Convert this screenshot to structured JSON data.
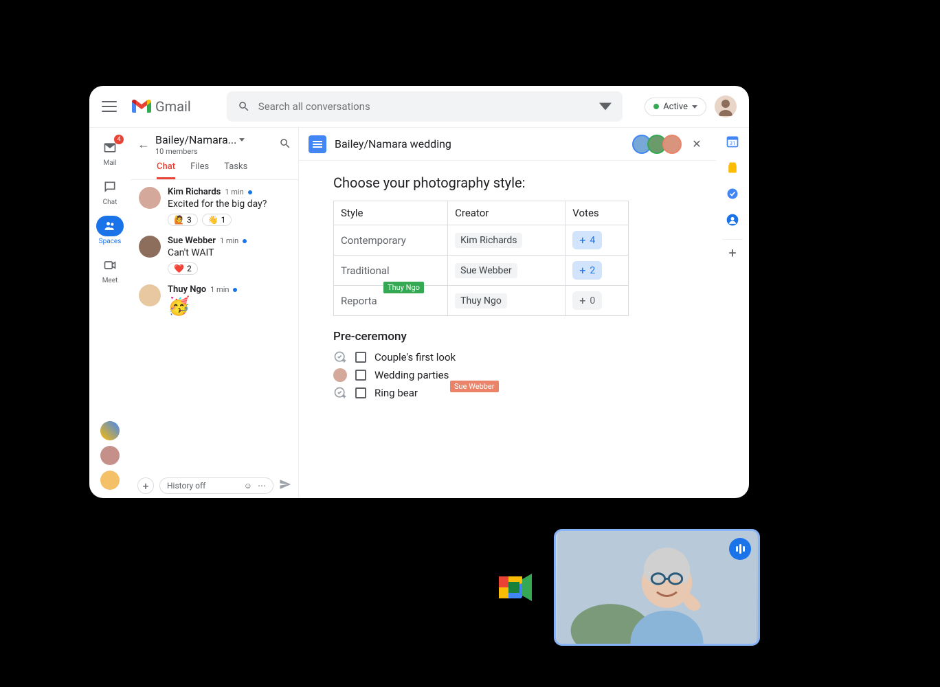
{
  "topbar": {
    "app_name": "Gmail",
    "search_placeholder": "Search all conversations",
    "status_label": "Active"
  },
  "leftrail": {
    "mail": {
      "label": "Mail",
      "badge": "4"
    },
    "chat": {
      "label": "Chat"
    },
    "spaces": {
      "label": "Spaces"
    },
    "meet": {
      "label": "Meet"
    }
  },
  "space": {
    "title": "Bailey/Namara...",
    "members": "10 members",
    "tabs": {
      "chat": "Chat",
      "files": "Files",
      "tasks": "Tasks"
    }
  },
  "messages": [
    {
      "name": "Kim Richards",
      "time": "1 min",
      "text": "Excited for the big day?",
      "reactions": [
        {
          "emoji": "🙋",
          "count": "3"
        },
        {
          "emoji": "👋",
          "count": "1"
        }
      ]
    },
    {
      "name": "Sue Webber",
      "time": "1 min",
      "text": "Can't WAIT",
      "reactions": [
        {
          "emoji": "❤️",
          "count": "2"
        }
      ]
    },
    {
      "name": "Thuy Ngo",
      "time": "1 min",
      "emoji": "🥳",
      "reactions": []
    }
  ],
  "compose": {
    "placeholder": "History off"
  },
  "doc": {
    "title": "Bailey/Namara wedding",
    "heading": "Choose your photography style:",
    "table": {
      "headers": {
        "style": "Style",
        "creator": "Creator",
        "votes": "Votes"
      },
      "rows": [
        {
          "style": "Contemporary",
          "creator": "Kim Richards",
          "votes": "4",
          "voted": true
        },
        {
          "style": "Traditional",
          "creator": "Sue Webber",
          "votes": "2",
          "voted": true
        },
        {
          "style": "Reporta",
          "creator": "Thuy Ngo",
          "votes": "0",
          "voted": false,
          "cursor": "Thuy Ngo"
        }
      ]
    },
    "section2": "Pre-ceremony",
    "checklist": [
      {
        "text": "Couple's first look",
        "assignee": "icon"
      },
      {
        "text": "Wedding parties",
        "assignee": "avatar"
      },
      {
        "text": "Ring bear",
        "assignee": "icon",
        "cursor": "Sue Webber"
      }
    ]
  }
}
